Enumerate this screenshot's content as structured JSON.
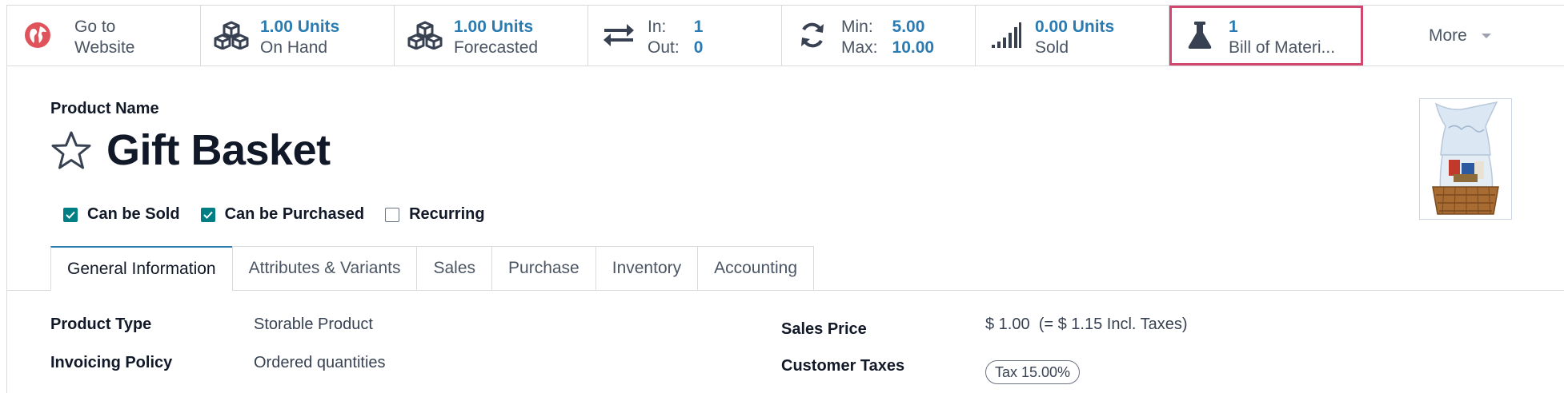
{
  "smart_buttons": {
    "website": {
      "line1": "Go to",
      "line2": "Website",
      "icon": "globe-icon"
    },
    "on_hand": {
      "value": "1.00 Units",
      "label": "On Hand",
      "icon": "cubes-icon"
    },
    "forecasted": {
      "value": "1.00 Units",
      "label": "Forecasted",
      "icon": "cubes-icon"
    },
    "in_out": {
      "in_label": "In:",
      "in_value": "1",
      "out_label": "Out:",
      "out_value": "0",
      "icon": "exchange-arrows-icon"
    },
    "min_max": {
      "min_label": "Min:",
      "min_value": "5.00",
      "max_label": "Max:",
      "max_value": "10.00",
      "icon": "refresh-icon"
    },
    "sold": {
      "value": "0.00 Units",
      "label": "Sold",
      "icon": "signal-bars-icon"
    },
    "bom": {
      "value": "1",
      "label": "Bill of Materi...",
      "icon": "flask-icon"
    },
    "more": {
      "label": "More"
    }
  },
  "product": {
    "name_label": "Product Name",
    "name": "Gift Basket",
    "favorite_icon": "star-icon"
  },
  "flags": [
    {
      "label": "Can be Sold",
      "checked": true
    },
    {
      "label": "Can be Purchased",
      "checked": true
    },
    {
      "label": "Recurring",
      "checked": false
    }
  ],
  "tabs": [
    "General Information",
    "Attributes & Variants",
    "Sales",
    "Purchase",
    "Inventory",
    "Accounting"
  ],
  "fields": {
    "product_type_label": "Product Type",
    "product_type_value": "Storable Product",
    "invoicing_policy_label": "Invoicing Policy",
    "invoicing_policy_value": "Ordered quantities",
    "sales_price_label": "Sales Price",
    "sales_price_value": "$ 1.00  (= $ 1.15 Incl. Taxes)",
    "customer_taxes_label": "Customer Taxes",
    "customer_taxes_tag": "Tax 15.00%"
  },
  "colors": {
    "accent": "#2b7bb0",
    "checkbox": "#017e84",
    "highlight": "#d0466d",
    "globe": "#e0535b"
  }
}
